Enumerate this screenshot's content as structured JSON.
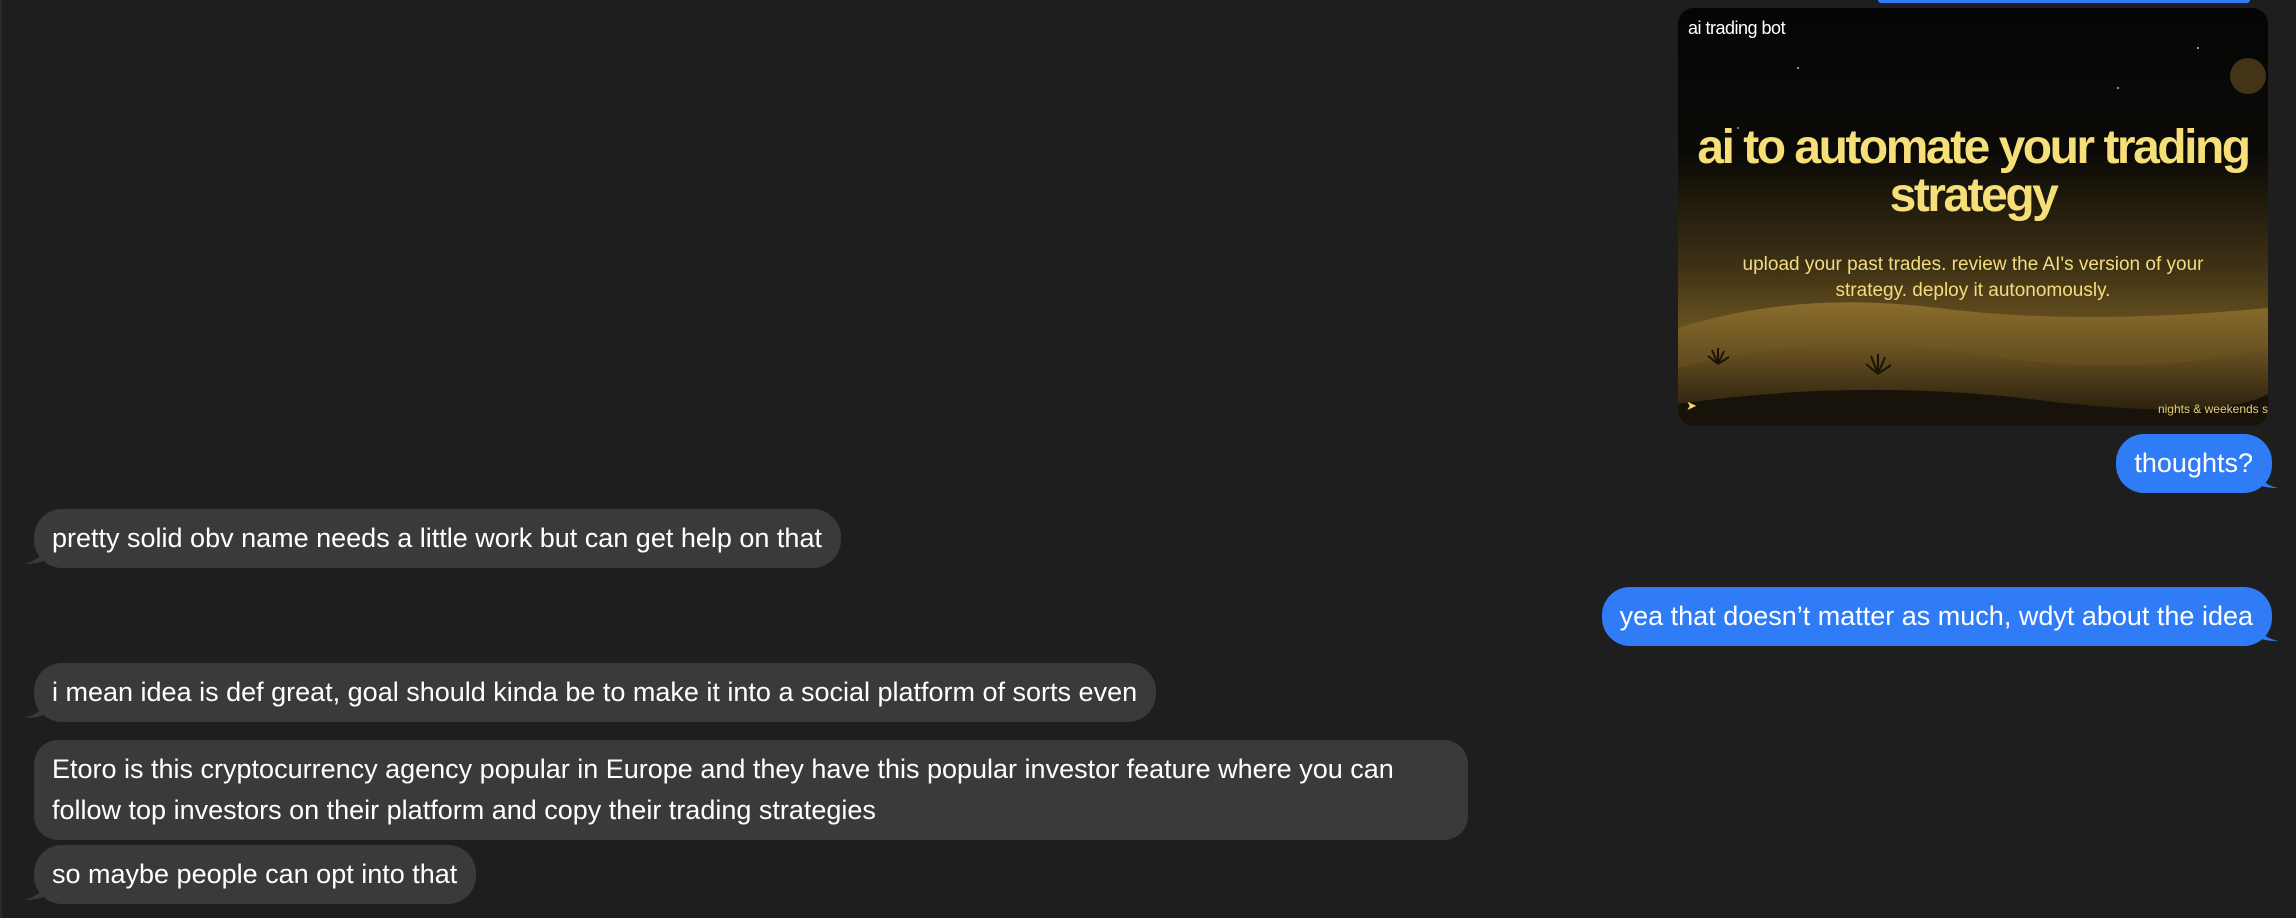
{
  "image_message": {
    "brand": "ai trading bot",
    "headline": "ai to automate your trading strategy",
    "subtitle": "upload your past trades. review the AI's version of your strategy. deploy it autonomously.",
    "footer": "nights & weekends s",
    "logo_icon": "bird-logo-icon"
  },
  "messages": [
    {
      "direction": "outgoing",
      "text": "thoughts?"
    },
    {
      "direction": "incoming",
      "text": "pretty solid obv name needs a little work but can get help on that"
    },
    {
      "direction": "outgoing",
      "text": "yea that doesn’t matter as much, wdyt about the idea"
    },
    {
      "direction": "incoming",
      "text": "i mean idea is def great, goal should kinda be to make it into a social platform of sorts even"
    },
    {
      "direction": "incoming",
      "text": "Etoro is this cryptocurrency agency popular in Europe and they have this popular investor feature where you can follow top investors on their platform and copy their trading strategies"
    },
    {
      "direction": "incoming",
      "text": "so maybe people can opt into that"
    }
  ],
  "colors": {
    "background": "#1e1e1e",
    "incoming_bubble": "#3a3a3c",
    "outgoing_bubble": "#2f7cf6",
    "headline_gold": "#f6df78"
  }
}
